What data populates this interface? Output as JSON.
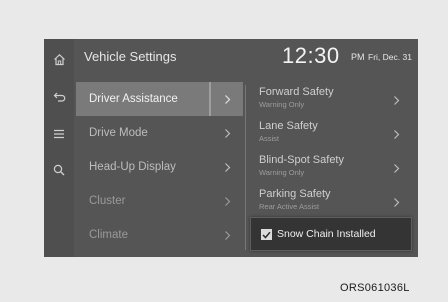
{
  "header": {
    "title": "Vehicle Settings",
    "time": "12:30",
    "ampm": "PM",
    "date": "Fri, Dec. 31"
  },
  "rail": {
    "icons": [
      "home-icon",
      "back-icon",
      "menu-icon",
      "search-icon"
    ]
  },
  "menu": {
    "items": [
      {
        "label": "Driver Assistance",
        "selected": true
      },
      {
        "label": "Drive Mode"
      },
      {
        "label": "Head-Up Display"
      },
      {
        "label": "Cluster"
      },
      {
        "label": "Climate"
      }
    ]
  },
  "submenu": {
    "items": [
      {
        "title": "Forward Safety",
        "subtitle": "Warning Only"
      },
      {
        "title": "Lane Safety",
        "subtitle": "Assist"
      },
      {
        "title": "Blind-Spot Safety",
        "subtitle": "Warning Only"
      },
      {
        "title": "Parking Safety",
        "subtitle": "Rear Active Assist"
      }
    ]
  },
  "popup": {
    "label": "Snow Chain Installed",
    "checked": true
  },
  "caption": "ORS061036L"
}
